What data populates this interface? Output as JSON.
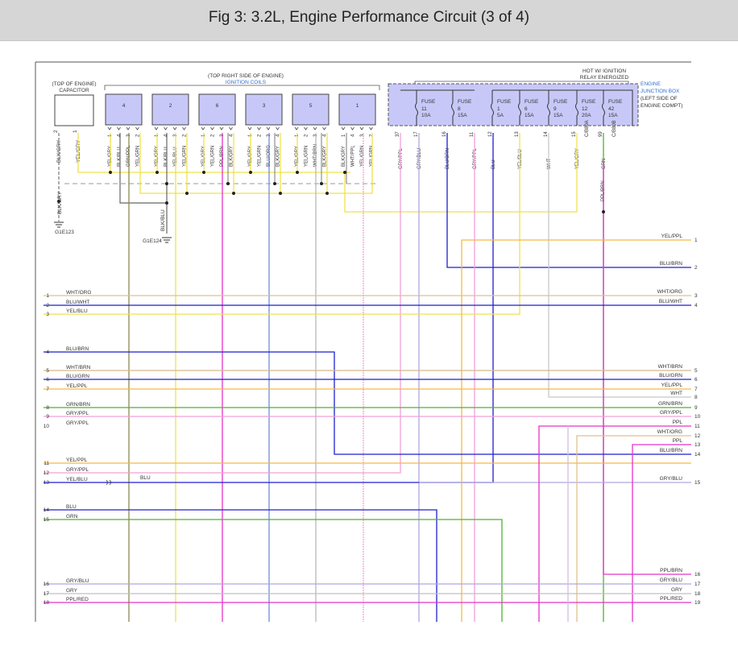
{
  "title": "Fig 3: 3.2L, Engine Performance Circuit (3 of 4)",
  "colors": {
    "blue": "#1f1fd0",
    "yellow": "#f0e24a",
    "orange": "#f5b942",
    "magenta": "#e533c9",
    "green": "#4cb52c",
    "olive": "#8a8a55",
    "lavender": "#b0a6e0",
    "gray": "#b8b8b8",
    "tan": "#e0c090",
    "pink": "#f0a0d8",
    "cyan": "#6f8fd8",
    "junction": "#c8c8f8",
    "dark": "#444444",
    "accent_blue": "#2f6fd0"
  },
  "labels": {
    "capacitor_top": "(TOP OF ENGINE)",
    "capacitor": "CAPACITOR",
    "coils_top": "(TOP RIGHT SIDE OF ENGINE)",
    "coils": "IGNITION COILS",
    "hot": "HOT W/ IGNITION",
    "relay": "RELAY ENERGIZED",
    "jb1": "ENGINE",
    "jb2": "JUNCTION BOX",
    "jb3": "(LEFT SIDE OF",
    "jb4": "ENGINE COMPT)",
    "ground1": "G1E123",
    "ground2": "G1E124",
    "gnd_wire1": "BLK/GRY",
    "gnd_wire2": "BLK/BLU",
    "blu_mid": "BLU"
  },
  "cap_pins": [
    {
      "num": "2",
      "wire": "BLK/GRY"
    },
    {
      "num": "1",
      "wire": "YEL/GRY"
    }
  ],
  "coils": [
    {
      "label": "4",
      "pins": [
        {
          "num": "1",
          "wire": "YEL/GRY"
        },
        {
          "num": "4",
          "wire": "BLK/BLU"
        },
        {
          "num": "3",
          "wire": "GRN/PPL"
        },
        {
          "num": "2",
          "wire": "YEL/GRN"
        }
      ]
    },
    {
      "label": "2",
      "pins": [
        {
          "num": "1",
          "wire": "YEL/GRY"
        },
        {
          "num": "4",
          "wire": "BLK/BLU"
        },
        {
          "num": "3",
          "wire": "YEL/BLU"
        },
        {
          "num": "2",
          "wire": "YEL/GRN"
        }
      ]
    },
    {
      "label": "6",
      "pins": [
        {
          "num": "1",
          "wire": "YEL/GRY"
        },
        {
          "num": "2",
          "wire": "YEL/GRN"
        },
        {
          "num": "3",
          "wire": "PPL/BRN"
        },
        {
          "num": "4",
          "wire": "BLK/GRY"
        }
      ]
    },
    {
      "label": "3",
      "pins": [
        {
          "num": "1",
          "wire": "YEL/GRY"
        },
        {
          "num": "2",
          "wire": "YEL/GRN"
        },
        {
          "num": "3",
          "wire": "BLU/ORG"
        },
        {
          "num": "4",
          "wire": "BLK/GRY"
        }
      ]
    },
    {
      "label": "5",
      "pins": [
        {
          "num": "1",
          "wire": "YEL/GRY"
        },
        {
          "num": "2",
          "wire": "YEL/GRN"
        },
        {
          "num": "3",
          "wire": "WHT/BRN"
        },
        {
          "num": "4",
          "wire": "BLK/GRY"
        }
      ]
    },
    {
      "label": "1",
      "pins": [
        {
          "num": "1",
          "wire": "BLK/GRY"
        },
        {
          "num": "4",
          "wire": "WHT/PPL"
        },
        {
          "num": "3",
          "wire": "YEL/GRN"
        },
        {
          "num": "2",
          "wire": "YEL/GRN"
        }
      ]
    }
  ],
  "fuses": [
    {
      "name": "FUSE",
      "num": "11",
      "amp": "10A"
    },
    {
      "name": "FUSE",
      "num": "8",
      "amp": "15A"
    },
    {
      "name": "FUSE",
      "num": "1",
      "amp": "5A"
    },
    {
      "name": "FUSE",
      "num": "6",
      "amp": "15A"
    },
    {
      "name": "FUSE",
      "num": "9",
      "amp": "15A"
    },
    {
      "name": "FUSE",
      "num": "12",
      "amp": "20A"
    },
    {
      "name": "FUSE",
      "num": "42",
      "amp": "15A"
    }
  ],
  "jb_pins": [
    {
      "num": "37",
      "wire": "GRY/PPL"
    },
    {
      "num": "17",
      "wire": "GRY/BLU"
    },
    {
      "num": "16",
      "wire": "BLU/BRN"
    },
    {
      "num": "11",
      "wire": "GRY/PPL"
    },
    {
      "num": "12",
      "wire": "BLU"
    },
    {
      "num": "13",
      "wire": "YEL/BLU"
    },
    {
      "num": "14",
      "wire": "WHT"
    },
    {
      "num": "15",
      "wire": "YEL/GRY"
    },
    {
      "num": "99",
      "wire": "GRN"
    },
    {
      "num": "C/B80A",
      "wire": ""
    },
    {
      "num": "C/B80B",
      "wire": ""
    }
  ],
  "jb_extra": "PPL/BRN",
  "left_groups": [
    {
      "items": [
        {
          "num": "1",
          "label": "WHT/ORG"
        },
        {
          "num": "2",
          "label": "BLU/WHT"
        },
        {
          "num": "3",
          "label": "YEL/BLU"
        }
      ]
    },
    {
      "items": [
        {
          "num": "4",
          "label": "BLU/BRN"
        }
      ]
    },
    {
      "items": [
        {
          "num": "5",
          "label": "WHT/BRN"
        },
        {
          "num": "6",
          "label": "BLU/GRN"
        },
        {
          "num": "7",
          "label": "YEL/PPL"
        }
      ]
    },
    {
      "items": [
        {
          "num": "8",
          "label": "GRN/BRN"
        },
        {
          "num": "9",
          "label": "GRY/PPL"
        },
        {
          "num": "10",
          "label": "GRY/PPL"
        }
      ]
    },
    {
      "items": [
        {
          "num": "11",
          "label": "YEL/PPL"
        },
        {
          "num": "12",
          "label": "GRY/PPL"
        },
        {
          "num": "13",
          "label": "YEL/BLU"
        }
      ]
    },
    {
      "items": [
        {
          "num": "14",
          "label": "BLU"
        },
        {
          "num": "15",
          "label": "GRN"
        }
      ]
    },
    {
      "items": [
        {
          "num": "16",
          "label": "GRY/BLU"
        },
        {
          "num": "17",
          "label": "GRY"
        },
        {
          "num": "18",
          "label": "PPL/RED"
        }
      ]
    }
  ],
  "right_groups": [
    {
      "items": [
        {
          "num": "1",
          "label": "YEL/PPL"
        }
      ]
    },
    {
      "items": [
        {
          "num": "2",
          "label": "BLU/BRN"
        }
      ]
    },
    {
      "items": [
        {
          "num": "3",
          "label": "WHT/ORG"
        },
        {
          "num": "4",
          "label": "BLU/WHT"
        }
      ]
    },
    {
      "items": [
        {
          "num": "5",
          "label": "WHT/BRN"
        },
        {
          "num": "6",
          "label": "BLU/GRN"
        },
        {
          "num": "7",
          "label": "YEL/PPL"
        },
        {
          "num": "8",
          "label": "WHT"
        },
        {
          "num": "9",
          "label": "GRN/BRN"
        },
        {
          "num": "10",
          "label": "GRY/PPL"
        },
        {
          "num": "11",
          "label": "PPL"
        },
        {
          "num": "12",
          "label": "WHT/ORG"
        },
        {
          "num": "13",
          "label": "PPL"
        },
        {
          "num": "14",
          "label": "BLU/BRN"
        }
      ]
    },
    {
      "items": [
        {
          "num": "15",
          "label": "GRY/BLU"
        }
      ]
    },
    {
      "items": [
        {
          "num": "16",
          "label": "PPL/BRN"
        },
        {
          "num": "17",
          "label": "GRY/BLU"
        },
        {
          "num": "18",
          "label": "GRY"
        },
        {
          "num": "19",
          "label": "PPL/RED"
        }
      ]
    }
  ]
}
